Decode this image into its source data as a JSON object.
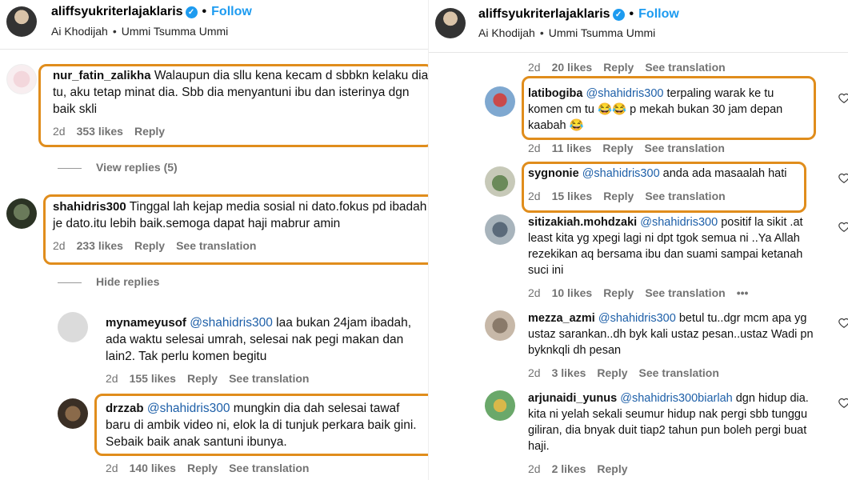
{
  "header": {
    "username": "aliffsyukriterlajaklaris",
    "follow_label": "Follow",
    "audio_artist": "Ai Khodijah",
    "audio_title": "Ummi Tsumma Ummi"
  },
  "labels": {
    "reply": "Reply",
    "see_translation": "See translation",
    "view_replies": "View replies (5)",
    "hide_replies": "Hide replies",
    "more": "•••"
  },
  "left_comments": [
    {
      "username": "nur_fatin_zalikha",
      "mention": "",
      "text": "Walaupun dia sllu kena kecam d sbbkn kelaku dia tu, aku tetap minat dia. Sbb dia menyantuni ibu dan isterinya dgn baik skli",
      "time": "2d",
      "likes": "353 likes"
    },
    {
      "username": "shahidris300",
      "mention": "",
      "text": "Tinggal lah kejap media sosial ni dato.fokus pd ibadah je dato.itu lebih baik.semoga dapat haji mabrur amin",
      "time": "2d",
      "likes": "233 likes"
    },
    {
      "username": "mynameyusof",
      "mention": "@shahidris300",
      "text": "laa bukan 24jam ibadah, ada waktu selesai umrah, selesai nak pegi makan dan lain2. Tak perlu komen begitu",
      "time": "2d",
      "likes": "155 likes"
    },
    {
      "username": "drzzab",
      "mention": "@shahidris300",
      "text": "mungkin dia dah selesai tawaf baru di ambik video ni, elok la di tunjuk perkara baik gini. Sebaik baik anak santuni ibunya.",
      "time": "2d",
      "likes": "140 likes"
    }
  ],
  "right_top_meta": {
    "time": "2d",
    "likes": "20 likes"
  },
  "right_comments": [
    {
      "username": "latibogiba",
      "mention": "@shahidris300",
      "text": "terpaling warak ke tu komen cm tu 😂😂 p mekah bukan 30 jam depan kaabah 😂",
      "time": "2d",
      "likes": "11 likes"
    },
    {
      "username": "sygnonie",
      "mention": "@shahidris300",
      "text": "anda ada masaalah hati",
      "time": "2d",
      "likes": "15 likes"
    },
    {
      "username": "sitizakiah.mohdzaki",
      "mention": "@shahidris300",
      "text": "positif la sikit .at least kita yg xpegi lagi ni dpt tgok semua ni ..Ya Allah rezekikan aq bersama ibu dan suami sampai ketanah suci ini",
      "time": "2d",
      "likes": "10 likes"
    },
    {
      "username": "mezza_azmi",
      "mention": "@shahidris300",
      "text": "betul tu..dgr mcm apa yg ustaz sarankan..dh byk kali ustaz pesan..ustaz Wadi pn byknkqli dh pesan",
      "time": "2d",
      "likes": "3 likes"
    },
    {
      "username": "arjunaidi_yunus",
      "mention": "@shahidris300biarlah",
      "text": "dgn hidup dia. kita ni yelah sekali seumur hidup nak pergi sbb tunggu giliran, dia bnyak duit tiap2 tahun pun boleh pergi buat haji.",
      "time": "2d",
      "likes": "2 likes"
    }
  ],
  "colors": {
    "highlight": "#e08d1c",
    "link": "#1d9bf0",
    "mention": "#1d5fa8",
    "meta": "#737373"
  }
}
